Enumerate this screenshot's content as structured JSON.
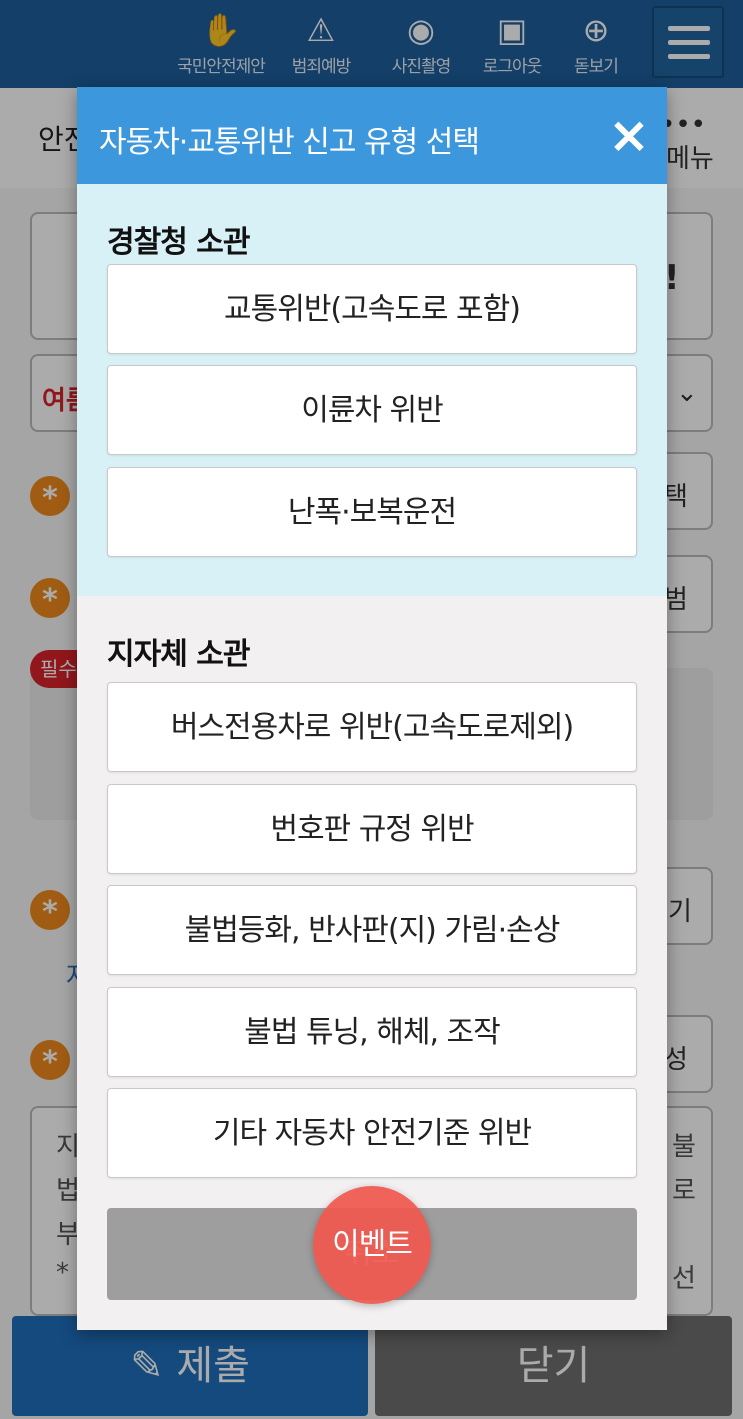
{
  "topnav": {
    "items": [
      {
        "label": "국민안전제안",
        "icon": "hand-shield-icon"
      },
      {
        "label": "범죄예방",
        "icon": "siren-icon"
      },
      {
        "label": "사진촬영",
        "icon": "camera-icon"
      },
      {
        "label": "로그아웃",
        "icon": "lock-icon"
      },
      {
        "label": "돋보기",
        "icon": "magnifier-icon"
      }
    ]
  },
  "subbar": {
    "title": "안전",
    "more": "•••",
    "menu_label": "메뉴"
  },
  "background": {
    "banner_text": "!",
    "dropdown_text": "여름",
    "btn_select": "택",
    "btn_2": "범",
    "btn_3": "기",
    "btn_4": "성",
    "required_pill": "필수",
    "link_text": "자",
    "text_lines": [
      "지",
      "법",
      "부",
      "*"
    ],
    "right_lines": [
      "불",
      "로",
      "",
      "선"
    ]
  },
  "footer": {
    "submit_label": "제출",
    "close_label": "닫기"
  },
  "modal": {
    "title": "자동차·교통위반 신고 유형 선택",
    "close_icon": "×",
    "police": {
      "title": "경찰청 소관",
      "options": [
        "교통위반(고속도로 포함)",
        "이륜차 위반",
        "난폭·보복운전"
      ]
    },
    "local": {
      "title": "지자체 소관",
      "options": [
        "버스전용차로 위반(고속도로제외)",
        "번호판 규정 위반",
        "불법등화, 반사판(지) 가림·손상",
        "불법 튜닝, 해체, 조작",
        "기타 자동차 안전기준 위반"
      ]
    },
    "cancel_label": "취소"
  },
  "event_badge": "이벤트",
  "colors": {
    "topbar": "#1d5f9b",
    "modal_header": "#3d97dd",
    "police_section": "#d8f1f7",
    "event_badge": "#f05850"
  }
}
